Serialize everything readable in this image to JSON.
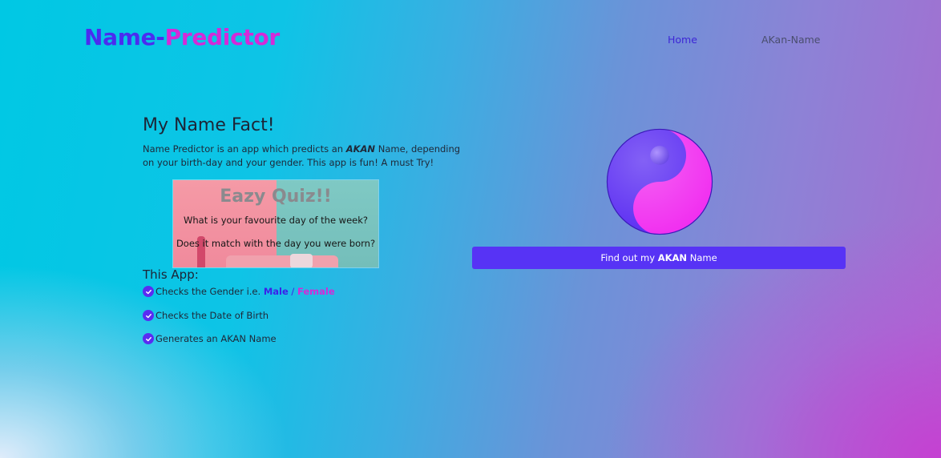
{
  "header": {
    "logo_part1": "Name-",
    "logo_part2": "Predictor",
    "nav": [
      {
        "label": "Home"
      },
      {
        "label": "AKan-Name"
      }
    ]
  },
  "main": {
    "heading": "My Name Fact!",
    "intro_pre": "Name Predictor is an app which predicts an ",
    "intro_emph": "AKAN",
    "intro_post": " Name, depending on your birth-day and your gender. This app is fun! A must Try!",
    "quiz": {
      "title": "Eazy Quiz!!",
      "question1": "What is your favourite day of the week?",
      "question2": "Does it match with the day you were born?"
    },
    "app_heading": "This App:",
    "features": [
      {
        "pre": "Checks the Gender i.e. ",
        "male": "Male",
        "sep": " / ",
        "female": "Female"
      },
      {
        "text": "Checks the Date of Birth"
      },
      {
        "text": "Generates an AKAN Name"
      }
    ]
  },
  "cta": {
    "pre": "Find out my ",
    "emph": "AKAN",
    "post": " Name"
  },
  "colors": {
    "accent": "#5733f5",
    "logo_blue": "#4b2cf0",
    "logo_pink": "#d42ad8"
  },
  "icons": [
    "check-circle-icon",
    "yin-yang-icon"
  ]
}
